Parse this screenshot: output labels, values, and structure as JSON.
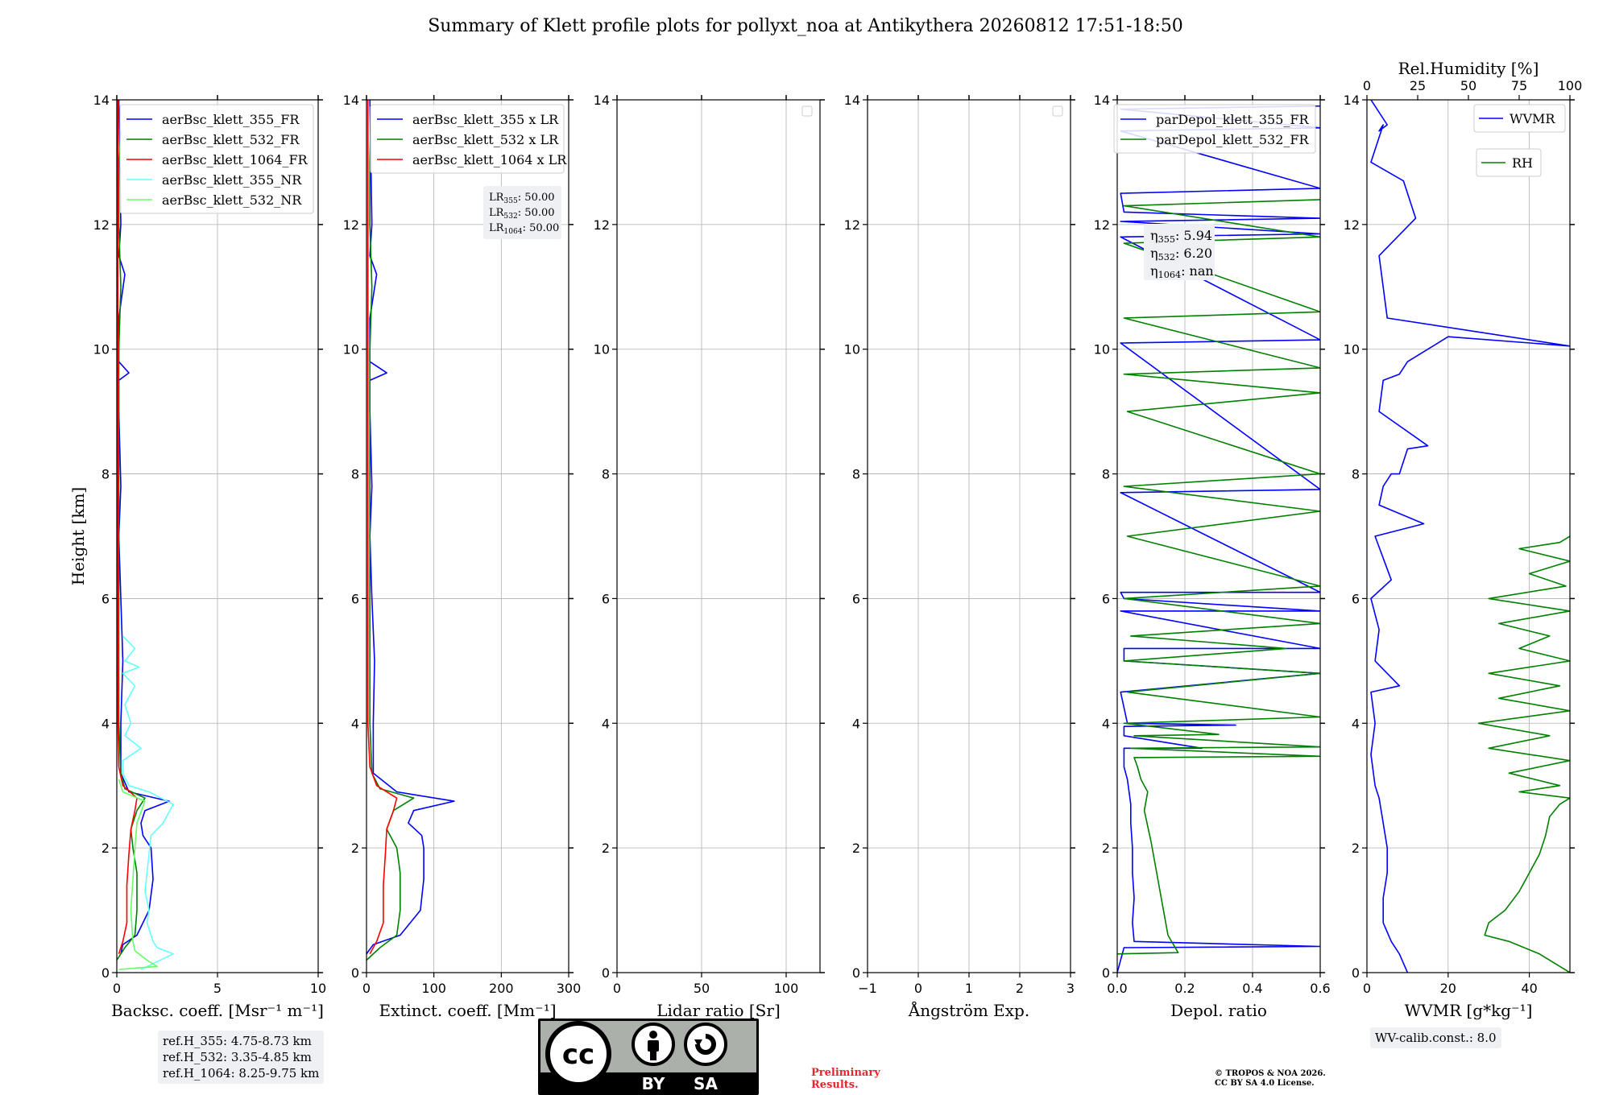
{
  "figure": {
    "title": "Summary of Klett profile plots for pollyxt_noa at Antikythera 20260812 17:51-18:50",
    "preliminary_label": "Preliminary\nResults.",
    "copyright": "© TROPOS & NOA 2026.\nCC BY SA 4.0 License.",
    "ref_heights": [
      "ref.H_355: 4.75-8.73 km",
      "ref.H_532: 3.35-4.85 km",
      "ref.H_1064: 8.25-9.75 km"
    ],
    "wv_calib": "WV-calib.const.: 8.0",
    "cc_license": {
      "cc": "cc",
      "by": "BY",
      "sa": "SA"
    },
    "colors": {
      "c355": "#0000ff",
      "c532": "#008000",
      "c1064": "#ff0000",
      "c355nr": "#66ffff",
      "c532nr": "#66ff66"
    }
  },
  "chart_data": [
    {
      "id": "bsc",
      "type": "line",
      "xlabel": "Backsc. coeff. [Msr⁻¹ m⁻¹]",
      "ylabel": "Height [km]",
      "xlim": [
        0,
        10
      ],
      "ylim": [
        0,
        14
      ],
      "xticks": [
        0,
        5,
        10
      ],
      "xtick_labels": [
        "0",
        "5",
        "10"
      ],
      "yticks": [
        0,
        2,
        4,
        6,
        8,
        10,
        12,
        14
      ],
      "ytick_labels": [
        "0",
        "2",
        "4",
        "6",
        "8",
        "10",
        "12",
        "14"
      ],
      "grid": true,
      "legend_position": "top-right",
      "series": [
        {
          "name": "aerBsc_klett_355_FR",
          "color": "#0000ff",
          "x": [
            0.2,
            0.3,
            1.0,
            1.6,
            1.8,
            1.7,
            1.3,
            1.2,
            1.4,
            2.6,
            0.6,
            0.2,
            0.2,
            0.3,
            0.2,
            0.1,
            0.2,
            0.1,
            0.1,
            0.6,
            0.1,
            0.1,
            0.4,
            0.1,
            0.2,
            0.1
          ],
          "y": [
            0.3,
            0.45,
            0.6,
            1.0,
            1.5,
            2.0,
            2.2,
            2.4,
            2.6,
            2.75,
            2.9,
            3.2,
            4.0,
            5.0,
            6.0,
            7.0,
            7.8,
            9.0,
            9.5,
            9.62,
            9.8,
            10.5,
            11.2,
            11.5,
            12.0,
            14.0
          ]
        },
        {
          "name": "aerBsc_klett_532_FR",
          "color": "#008000",
          "x": [
            0.0,
            0.4,
            0.9,
            1.0,
            1.0,
            0.8,
            0.7,
            1.0,
            1.4,
            0.4,
            0.2,
            0.1,
            0.1,
            0.1,
            0.1,
            0.2,
            0.1,
            0.1,
            0.1,
            0.2
          ],
          "y": [
            0.2,
            0.4,
            0.6,
            1.0,
            1.6,
            2.0,
            2.3,
            2.6,
            2.8,
            2.95,
            3.2,
            4.0,
            6.0,
            8.0,
            10.0,
            11.0,
            12.0,
            12.5,
            13.0,
            13.5
          ]
        },
        {
          "name": "aerBsc_klett_1064_FR",
          "color": "#ff0000",
          "x": [
            0.1,
            0.3,
            0.5,
            0.5,
            0.6,
            0.7,
            0.9,
            1.0,
            0.3,
            0.1,
            0.05,
            0.05,
            0.05
          ],
          "y": [
            0.3,
            0.5,
            0.8,
            1.4,
            1.9,
            2.3,
            2.6,
            2.8,
            3.0,
            3.3,
            4.0,
            8.0,
            14.0
          ]
        },
        {
          "name": "aerBsc_klett_355_NR",
          "color": "#66ffff",
          "x": [
            1.2,
            2.8,
            2.0,
            1.8,
            1.5,
            1.6,
            1.4,
            1.5,
            1.6,
            1.7,
            2.3,
            2.8,
            1.6,
            0.6,
            0.3,
            0.3,
            1.2,
            0.4,
            0.7,
            0.4,
            0.9,
            0.6,
            0.3,
            1.1,
            0.4,
            0.9,
            0.3
          ],
          "y": [
            0.05,
            0.3,
            0.4,
            0.5,
            0.8,
            1.0,
            1.3,
            1.6,
            1.9,
            2.2,
            2.4,
            2.7,
            2.9,
            3.0,
            3.2,
            3.4,
            3.6,
            3.8,
            4.0,
            4.3,
            4.6,
            4.7,
            4.8,
            4.9,
            5.0,
            5.2,
            5.4
          ]
        },
        {
          "name": "aerBsc_klett_532_NR",
          "color": "#66ff66",
          "x": [
            0.1,
            2.0,
            1.5,
            0.9,
            0.8,
            0.7,
            0.8,
            0.9,
            1.0,
            1.4,
            0.3,
            0.1
          ],
          "y": [
            0.05,
            0.1,
            0.2,
            0.35,
            0.5,
            1.0,
            1.5,
            2.0,
            2.4,
            2.75,
            2.9,
            3.1
          ]
        }
      ]
    },
    {
      "id": "ext",
      "type": "line",
      "xlabel": "Extinct. coeff. [Mm⁻¹]",
      "xlim": [
        0,
        300
      ],
      "ylim": [
        0,
        14
      ],
      "xticks": [
        0,
        100,
        200,
        300
      ],
      "xtick_labels": [
        "0",
        "100",
        "200",
        "300"
      ],
      "yticks": [
        0,
        2,
        4,
        6,
        8,
        10,
        12,
        14
      ],
      "ytick_labels": [
        "0",
        "2",
        "4",
        "6",
        "8",
        "10",
        "12",
        "14"
      ],
      "grid": true,
      "legend_position": "top-right",
      "annotation": [
        "LR355: 50.00",
        "LR532: 50.00",
        "LR1064: 50.00"
      ],
      "series": [
        {
          "name": "aerBsc_klett_355 x LR",
          "color": "#0000ff",
          "x": [
            0,
            10,
            50,
            80,
            85,
            85,
            82,
            62,
            70,
            130,
            45,
            10,
            10,
            12,
            8,
            5,
            8,
            5,
            5,
            30,
            5,
            5,
            15,
            5,
            8,
            5
          ],
          "y": [
            0.3,
            0.45,
            0.6,
            1.0,
            1.5,
            2.0,
            2.2,
            2.4,
            2.6,
            2.75,
            2.9,
            3.2,
            4.0,
            5.0,
            6.0,
            7.0,
            7.8,
            9.0,
            9.5,
            9.62,
            9.8,
            10.5,
            11.2,
            11.5,
            12.0,
            14.0
          ]
        },
        {
          "name": "aerBsc_klett_532 x LR",
          "color": "#008000",
          "x": [
            0,
            20,
            45,
            50,
            50,
            45,
            30,
            40,
            70,
            20,
            8,
            5,
            5,
            5,
            5,
            8,
            5,
            5,
            5,
            6
          ],
          "y": [
            0.2,
            0.4,
            0.6,
            1.0,
            1.6,
            2.0,
            2.3,
            2.6,
            2.8,
            2.95,
            3.2,
            4.0,
            6.0,
            8.0,
            10.0,
            11.0,
            12.0,
            12.5,
            13.0,
            13.5
          ]
        },
        {
          "name": "aerBsc_klett_1064 x LR",
          "color": "#ff0000",
          "x": [
            5,
            15,
            25,
            25,
            28,
            30,
            40,
            45,
            15,
            5,
            2,
            2,
            2
          ],
          "y": [
            0.3,
            0.5,
            0.8,
            1.4,
            1.9,
            2.3,
            2.6,
            2.8,
            3.0,
            3.3,
            4.0,
            8.0,
            14.0
          ]
        }
      ]
    },
    {
      "id": "lr",
      "type": "line",
      "xlabel": "Lidar ratio [Sr]",
      "xlim": [
        0,
        120
      ],
      "ylim": [
        0,
        14
      ],
      "xticks": [
        0,
        50,
        100
      ],
      "xtick_labels": [
        "0",
        "50",
        "100"
      ],
      "yticks": [
        0,
        2,
        4,
        6,
        8,
        10,
        12,
        14
      ],
      "ytick_labels": [
        "0",
        "2",
        "4",
        "6",
        "8",
        "10",
        "12",
        "14"
      ],
      "grid": true,
      "legend_position": "top-right",
      "series": []
    },
    {
      "id": "ae",
      "type": "line",
      "xlabel": "Ångström Exp.",
      "xlim": [
        -1,
        3
      ],
      "ylim": [
        0,
        14
      ],
      "xticks": [
        -1,
        0,
        1,
        2,
        3
      ],
      "xtick_labels": [
        "−1",
        "0",
        "1",
        "2",
        "3"
      ],
      "yticks": [
        0,
        2,
        4,
        6,
        8,
        10,
        12,
        14
      ],
      "ytick_labels": [
        "0",
        "2",
        "4",
        "6",
        "8",
        "10",
        "12",
        "14"
      ],
      "grid": true,
      "legend_position": "top-right",
      "series": []
    },
    {
      "id": "depol",
      "type": "line",
      "xlabel": "Depol. ratio",
      "xlim": [
        0,
        0.6
      ],
      "ylim": [
        0,
        14
      ],
      "xticks": [
        0,
        0.2,
        0.4,
        0.6
      ],
      "xtick_labels": [
        "0.0",
        "0.2",
        "0.4",
        "0.6"
      ],
      "yticks": [
        0,
        2,
        4,
        6,
        8,
        10,
        12,
        14
      ],
      "ytick_labels": [
        "0",
        "2",
        "4",
        "6",
        "8",
        "10",
        "12",
        "14"
      ],
      "grid": true,
      "legend_position": "top-right",
      "annotation": [
        "η355: 5.94",
        "η532: 6.20",
        "η1064: nan"
      ],
      "series": [
        {
          "name": "parDepol_klett_355_FR",
          "color": "#0000ff",
          "x": [
            0.0,
            0.02,
            0.6,
            0.05,
            0.045,
            0.05,
            0.045,
            0.045,
            0.04,
            0.04,
            0.035,
            0.03,
            0.02,
            0.02,
            0.25,
            0.02,
            0.02,
            0.35,
            0.03,
            0.01,
            0.6,
            0.02,
            0.02,
            0.6,
            0.01,
            0.6,
            0.02,
            0.01,
            0.6,
            0.01,
            0.6,
            0.01,
            0.6,
            0.01,
            0.6,
            0.01,
            0.6,
            0.02,
            0.01,
            0.6,
            0.01,
            0.6,
            0.01,
            0.6
          ],
          "y": [
            0.0,
            0.4,
            0.42,
            0.5,
            0.8,
            1.2,
            1.6,
            2.0,
            2.4,
            2.7,
            2.9,
            3.1,
            3.3,
            3.6,
            3.6,
            3.8,
            3.95,
            3.97,
            4.0,
            4.5,
            4.8,
            5.0,
            5.2,
            5.2,
            5.8,
            5.8,
            6.0,
            6.1,
            6.1,
            7.7,
            7.75,
            10.1,
            10.15,
            11.8,
            11.85,
            12.05,
            12.1,
            12.2,
            12.5,
            12.58,
            13.5,
            13.55,
            13.85,
            13.9
          ]
        },
        {
          "name": "parDepol_klett_532_FR",
          "color": "#008000",
          "x": [
            0.0,
            0.18,
            0.15,
            0.14,
            0.13,
            0.12,
            0.11,
            0.1,
            0.08,
            0.09,
            0.07,
            0.06,
            0.05,
            0.6,
            0.04,
            0.6,
            0.05,
            0.3,
            0.02,
            0.6,
            0.03,
            0.6,
            0.02,
            0.5,
            0.04,
            0.6,
            0.02,
            0.6,
            0.03,
            0.6,
            0.02,
            0.6,
            0.03,
            0.6,
            0.02,
            0.6,
            0.02,
            0.6,
            0.02,
            0.6,
            0.02,
            0.6
          ],
          "y": [
            0.3,
            0.32,
            0.6,
            0.9,
            1.2,
            1.5,
            1.8,
            2.1,
            2.6,
            2.9,
            3.1,
            3.3,
            3.45,
            3.47,
            3.6,
            3.62,
            3.8,
            3.82,
            4.0,
            4.1,
            4.5,
            4.8,
            5.0,
            5.2,
            5.4,
            5.6,
            6.0,
            6.2,
            7.0,
            7.4,
            7.8,
            8.0,
            9.0,
            9.3,
            9.6,
            9.7,
            10.5,
            10.6,
            11.7,
            11.8,
            12.3,
            12.4
          ]
        }
      ]
    },
    {
      "id": "wv",
      "type": "line",
      "xlabel": "WVMR [g*kg⁻¹]",
      "xlim": [
        0,
        50
      ],
      "ylim": [
        0,
        14
      ],
      "xticks": [
        0,
        20,
        40
      ],
      "xtick_labels": [
        "0",
        "20",
        "40"
      ],
      "x2label": "Rel.Humidity [%]",
      "x2lim": [
        0,
        100
      ],
      "x2ticks": [
        0,
        25,
        50,
        75,
        100
      ],
      "x2tick_labels": [
        "0",
        "25",
        "50",
        "75",
        "100"
      ],
      "yticks": [
        0,
        2,
        4,
        6,
        8,
        10,
        12,
        14
      ],
      "ytick_labels": [
        "0",
        "2",
        "4",
        "6",
        "8",
        "10",
        "12",
        "14"
      ],
      "grid": true,
      "legend_position": "top-right",
      "series": [
        {
          "name": "WVMR",
          "color": "#0000ff",
          "x": [
            10,
            8,
            6,
            4,
            4,
            5,
            5,
            4,
            3,
            2,
            1,
            2,
            1,
            8,
            2,
            3,
            1,
            6,
            2,
            14,
            3,
            4,
            6,
            8,
            10,
            15,
            3,
            4,
            8,
            10,
            20,
            50,
            5,
            3,
            12,
            9,
            1,
            4,
            3,
            5,
            1
          ],
          "y": [
            0.0,
            0.3,
            0.5,
            0.8,
            1.2,
            1.6,
            2.0,
            2.4,
            2.8,
            3.0,
            3.5,
            4.0,
            4.5,
            4.6,
            5.0,
            5.5,
            6.0,
            6.3,
            7.0,
            7.2,
            7.5,
            7.8,
            8.0,
            8.0,
            8.4,
            8.45,
            9.0,
            9.5,
            9.6,
            9.8,
            10.2,
            10.05,
            10.5,
            11.5,
            12.1,
            12.7,
            13.0,
            13.6,
            13.5,
            13.6,
            14.0
          ]
        },
        {
          "name": "RH",
          "color": "#008000",
          "x": [
            100,
            85,
            70,
            58,
            60,
            68,
            75,
            80,
            85,
            88,
            90,
            95,
            100,
            75,
            95,
            70,
            100,
            60,
            90,
            55,
            100,
            65,
            95,
            60,
            100,
            75,
            90,
            65,
            100,
            60,
            98,
            80,
            100,
            75,
            95,
            100
          ],
          "y": [
            0.0,
            0.3,
            0.5,
            0.6,
            0.8,
            1.0,
            1.3,
            1.6,
            1.9,
            2.2,
            2.5,
            2.7,
            2.8,
            2.9,
            3.0,
            3.2,
            3.4,
            3.6,
            3.8,
            4.0,
            4.2,
            4.4,
            4.6,
            4.8,
            5.0,
            5.2,
            5.4,
            5.6,
            5.8,
            6.0,
            6.2,
            6.4,
            6.6,
            6.8,
            6.9,
            7.0
          ]
        }
      ]
    }
  ]
}
